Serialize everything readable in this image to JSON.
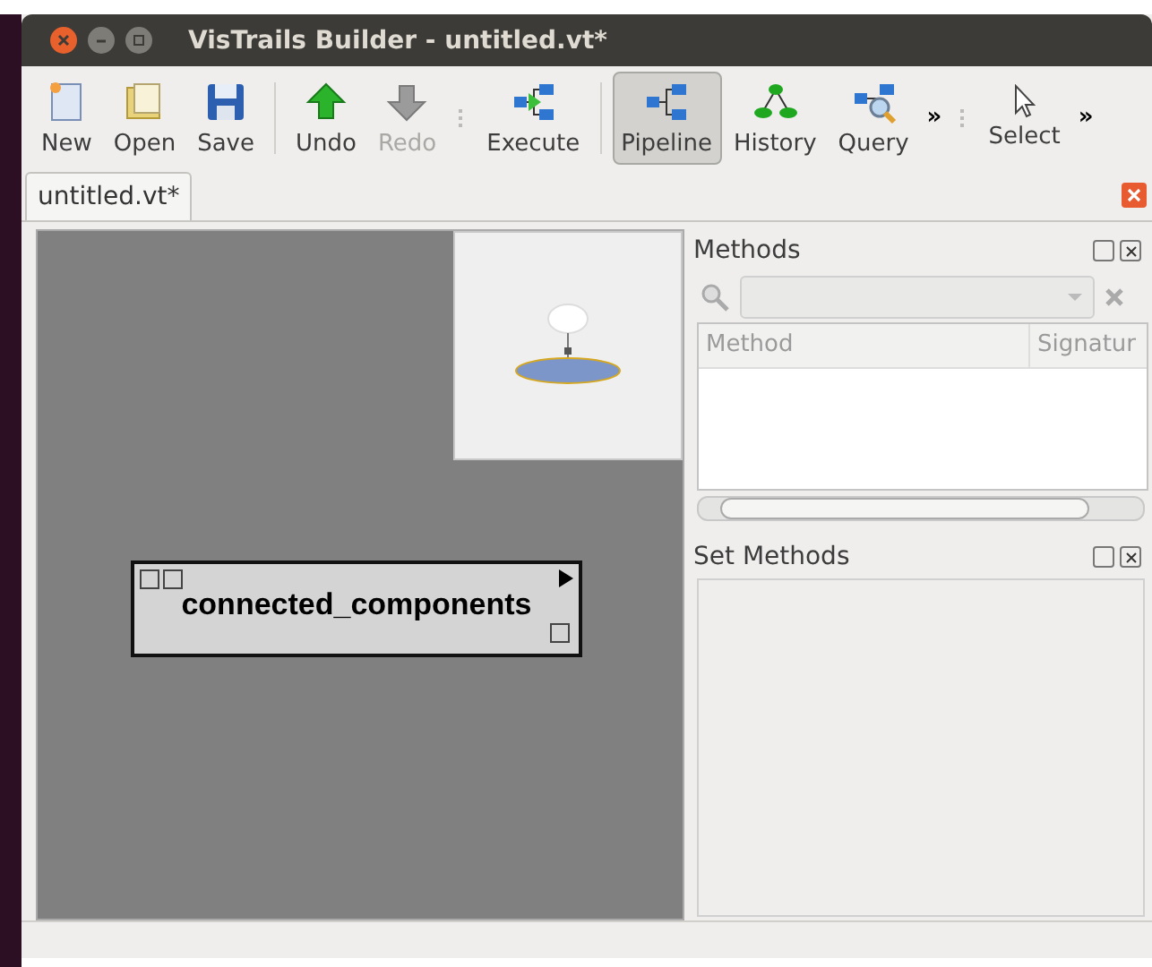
{
  "window": {
    "title": "VisTrails Builder - untitled.vt*"
  },
  "toolbar": [
    {
      "kind": "new",
      "label": "New",
      "disabled": false,
      "selected": false
    },
    {
      "kind": "open",
      "label": "Open",
      "disabled": false,
      "selected": false
    },
    {
      "kind": "save",
      "label": "Save",
      "disabled": false,
      "selected": false
    },
    {
      "kind": "separator"
    },
    {
      "kind": "undo",
      "label": "Undo",
      "disabled": false,
      "selected": false
    },
    {
      "kind": "redo",
      "label": "Redo",
      "disabled": true,
      "selected": false
    },
    {
      "kind": "grip"
    },
    {
      "kind": "execute",
      "label": "Execute",
      "disabled": false,
      "selected": false
    },
    {
      "kind": "separator"
    },
    {
      "kind": "pipeline",
      "label": "Pipeline",
      "disabled": false,
      "selected": true
    },
    {
      "kind": "history",
      "label": "History",
      "disabled": false,
      "selected": false
    },
    {
      "kind": "query",
      "label": "Query",
      "disabled": false,
      "selected": false
    },
    {
      "kind": "more",
      "label": "»"
    },
    {
      "kind": "grip"
    },
    {
      "kind": "select",
      "label": "Select",
      "disabled": false,
      "selected": false
    },
    {
      "kind": "more",
      "label": "»"
    }
  ],
  "tabs": [
    {
      "label": "untitled.vt*",
      "selected": true
    }
  ],
  "canvas": {
    "module": {
      "name": "connected_components"
    }
  },
  "methods_panel": {
    "title": "Methods",
    "columns": [
      "Method",
      "Signatur"
    ]
  },
  "set_methods_panel": {
    "title": "Set Methods"
  }
}
